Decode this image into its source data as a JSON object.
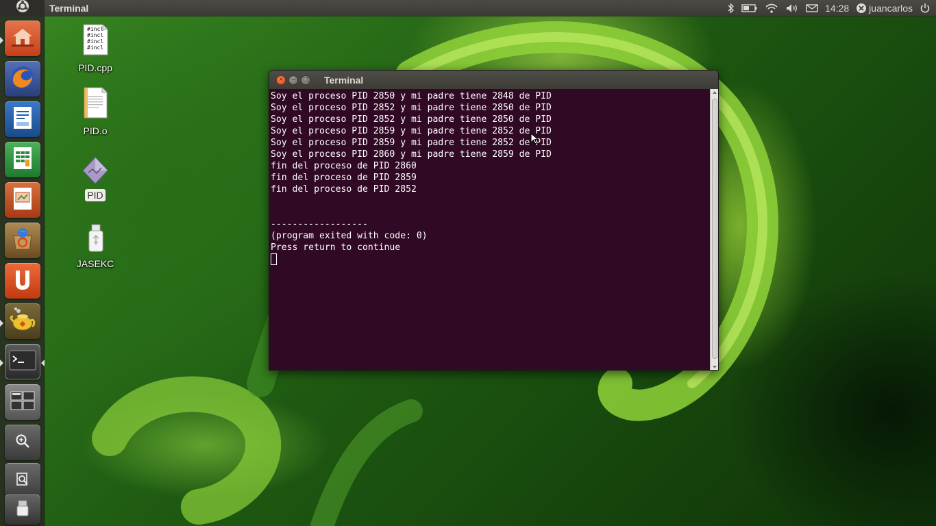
{
  "top_panel": {
    "title": "Terminal",
    "time": "14:28",
    "user": "juancarlos",
    "icons": [
      "ubuntu-logo-icon",
      "bluetooth-icon",
      "battery-icon",
      "wifi-icon",
      "volume-icon",
      "mail-icon",
      "user-status-icon",
      "power-icon"
    ]
  },
  "launcher": {
    "items": [
      {
        "name": "home-folder",
        "icon": "home-folder-icon",
        "color": "#dd4814"
      },
      {
        "name": "firefox",
        "icon": "firefox-icon",
        "color": "#e66000"
      },
      {
        "name": "libreoffice-writer",
        "icon": "writer-icon",
        "color": "#1f5fa8"
      },
      {
        "name": "libreoffice-calc",
        "icon": "calc-icon",
        "color": "#2a8d3a"
      },
      {
        "name": "libreoffice-impress",
        "icon": "impress-icon",
        "color": "#c0502a"
      },
      {
        "name": "software-center",
        "icon": "software-center-icon",
        "color": "#8a6a3a"
      },
      {
        "name": "ubuntu-one",
        "icon": "ubuntu-one-icon",
        "color": "#dd4814"
      },
      {
        "name": "geany",
        "icon": "geany-icon",
        "color": "#b8a030"
      },
      {
        "name": "terminal",
        "icon": "terminal-icon",
        "color": "#2c2c2c"
      },
      {
        "name": "workspace-switcher",
        "icon": "workspace-switcher-icon",
        "color": "#6a6a6a"
      },
      {
        "name": "dash-search",
        "icon": "search-icon",
        "color": "#5a5a5a"
      },
      {
        "name": "usb-drive",
        "icon": "usb-drive-icon",
        "color": "#5a5a5a"
      }
    ]
  },
  "desktop": {
    "icons": [
      {
        "label": "PID.cpp",
        "icon": "cpp-file-icon",
        "preview": [
          "#incl",
          "#incl",
          "#incl",
          "#incl"
        ]
      },
      {
        "label": "PID.o",
        "icon": "object-file-icon"
      },
      {
        "label": "PID",
        "icon": "executable-icon"
      },
      {
        "label": "JASEKC",
        "icon": "usb-drive-icon"
      }
    ]
  },
  "terminal": {
    "title": "Terminal",
    "lines": [
      "Soy el proceso PID 2850 y mi padre tiene 2848 de PID",
      "Soy el proceso PID 2852 y mi padre tiene 2850 de PID",
      "Soy el proceso PID 2852 y mi padre tiene 2850 de PID",
      "Soy el proceso PID 2859 y mi padre tiene 2852 de PID",
      "Soy el proceso PID 2859 y mi padre tiene 2852 de PID",
      "Soy el proceso PID 2860 y mi padre tiene 2859 de PID",
      "fin del proceso de PID 2860",
      "fin del proceso de PID 2859",
      "fin del proceso de PID 2852",
      "",
      "",
      "------------------",
      "(program exited with code: 0)",
      "Press return to continue"
    ],
    "bg_color": "#300a24"
  }
}
